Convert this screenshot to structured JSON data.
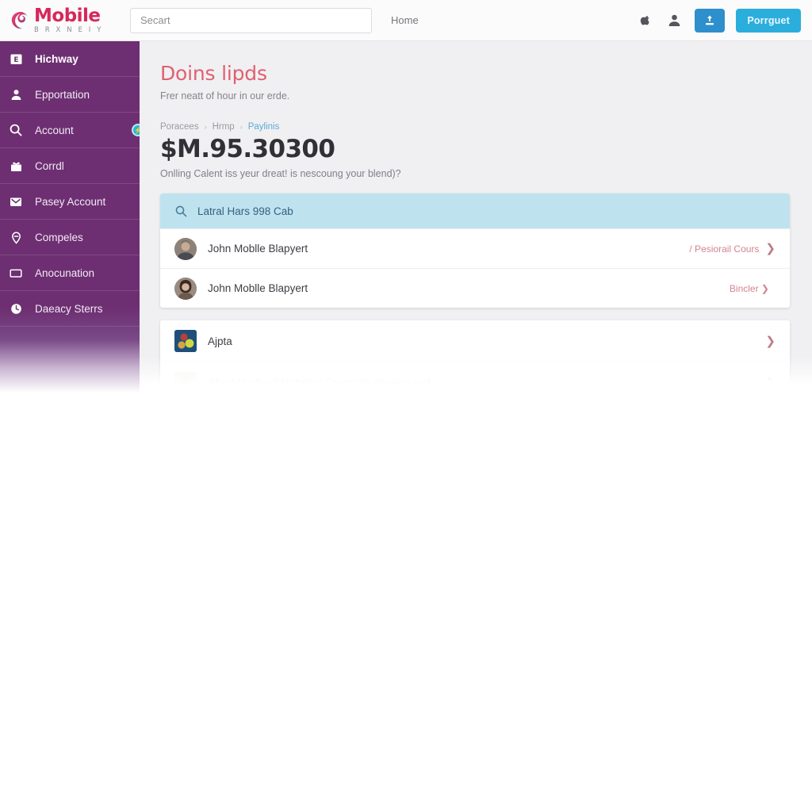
{
  "brand": {
    "name": "Mobile",
    "subtitle": "B R X N  E I Y",
    "logo_icon": "swirl-logo-icon"
  },
  "topbar": {
    "search_placeholder": "Secart",
    "search_value": "",
    "nav": [
      {
        "label": "Home",
        "name": "nav-home"
      }
    ],
    "icons": [
      {
        "name": "bag-icon",
        "label": "bag-icon"
      },
      {
        "name": "user-icon",
        "label": "user-icon"
      }
    ],
    "primary_icon_button": {
      "name": "upload-button",
      "icon": "upload-icon",
      "color": "#2e8fcd"
    },
    "primary_button": {
      "label": "Porrguet",
      "color": "#2baedc"
    }
  },
  "sidebar": {
    "background": "#6d2f72",
    "items": [
      {
        "label": "Hichway",
        "icon": "calendar-icon",
        "active": true,
        "badge": null
      },
      {
        "label": "Epportation",
        "icon": "person-icon",
        "active": false,
        "badge": null
      },
      {
        "label": "Account",
        "icon": "search-icon",
        "active": false,
        "badge": "⚡"
      },
      {
        "label": "Corrdl",
        "icon": "gift-icon",
        "active": false,
        "badge": null
      },
      {
        "label": "Pasey Account",
        "icon": "inbox-icon",
        "active": false,
        "badge": null
      },
      {
        "label": "Compeles",
        "icon": "map-pin-icon",
        "active": false,
        "badge": null
      },
      {
        "label": "Anocunation",
        "icon": "monitor-icon",
        "active": false,
        "badge": null
      },
      {
        "label": "Daeacy Sterrs",
        "icon": "clock-icon",
        "active": false,
        "badge": null
      }
    ]
  },
  "main": {
    "title": "Doins lipds",
    "subtitle": "Frer neatt of hour in our erde.",
    "breadcrumb": [
      {
        "label": "Poracees",
        "current": false
      },
      {
        "label": "Hrmp",
        "current": false
      },
      {
        "label": "Paylinis",
        "current": true
      }
    ],
    "breadcrumb_separator": "›",
    "amount": "$M.95.30300",
    "amount_note": "Onlling Calent iss yeur dreat! is nescoung your blend)?",
    "card_search": {
      "icon": "search-icon",
      "text": "Latral Hars 998 Cab",
      "background": "#bfe2ef"
    },
    "rows": [
      {
        "name": "John Moblle Blapyert",
        "avatar": "avatar-man",
        "action_label": "/ Pesiorail Cours",
        "chevron": "❯"
      },
      {
        "name": "John Moblle Blapyert",
        "avatar": "avatar-woman",
        "action_label": "Bincler ❯",
        "chevron": ""
      }
    ],
    "rows2": [
      {
        "name": "Ajpta",
        "avatar": "avatar-thumb",
        "action_label": "",
        "chevron": "❯",
        "faded": false
      },
      {
        "name": "AfyoANwrls wll Hnbsher Ouysttute Breeing nial",
        "avatar": "avatar-thumb2",
        "action_label": "",
        "chevron": "❯",
        "faded": true
      }
    ]
  }
}
